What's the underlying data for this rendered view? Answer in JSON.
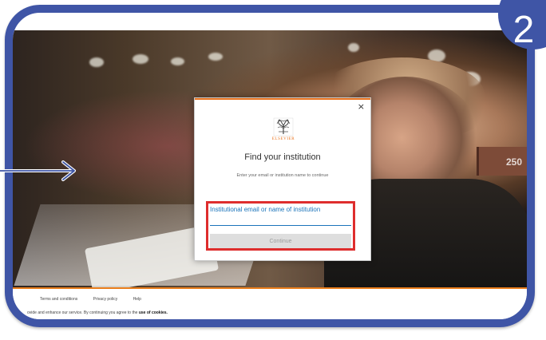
{
  "badge": {
    "number": "2"
  },
  "modal": {
    "close_symbol": "×",
    "logo_text": "ELSEVIER",
    "title": "Find your institution",
    "subtitle": "Enter your email or institution name to continue",
    "input_label": "Institutional email or name of institution",
    "continue_label": "Continue"
  },
  "background": {
    "nameplate_text": "250"
  },
  "footer": {
    "links": [
      "Terms and conditions",
      "Privacy policy",
      "Help"
    ],
    "cookie_notice": "ovide and enhance our service. By continuing you agree to the",
    "cookie_link": "use of cookies."
  },
  "colors": {
    "frame": "#3f55a6",
    "accent": "#e9711c",
    "highlight": "#de2d2d",
    "link": "#1b74ba"
  },
  "icons": {
    "close": "close-icon",
    "logo": "elsevier-tree-icon",
    "pointer": "arrow-right-icon"
  }
}
